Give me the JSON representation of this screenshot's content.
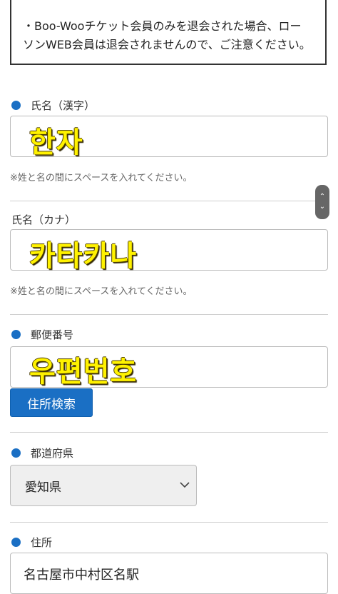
{
  "notice": {
    "text": "・Boo-Wooチケット会員のみを退会された場合、ローソンWEB会員は退会されませんので、ご注意ください。"
  },
  "fields": {
    "name_kanji": {
      "label": "氏名（漢字）",
      "handwritten": "한자",
      "hint": "※姓と名の間にスペースを入れてください。"
    },
    "name_kana": {
      "label": "氏名（カナ）",
      "handwritten": "카타카나",
      "hint": "※姓と名の間にスペースを入れてください。"
    },
    "postal": {
      "label": "郵便番号",
      "handwritten": "우편번호",
      "search_button": "住所検索"
    },
    "prefecture": {
      "label": "都道府県",
      "selected": "愛知県"
    },
    "address": {
      "label": "住所",
      "value": "名古屋市中村区名駅"
    }
  },
  "colors": {
    "accent": "#1a6fc4",
    "handwriting": "#fff200"
  },
  "icons": {
    "scroll_up": "chevron-up-icon",
    "scroll_down": "chevron-down-icon",
    "select_arrow": "chevron-down-icon"
  }
}
